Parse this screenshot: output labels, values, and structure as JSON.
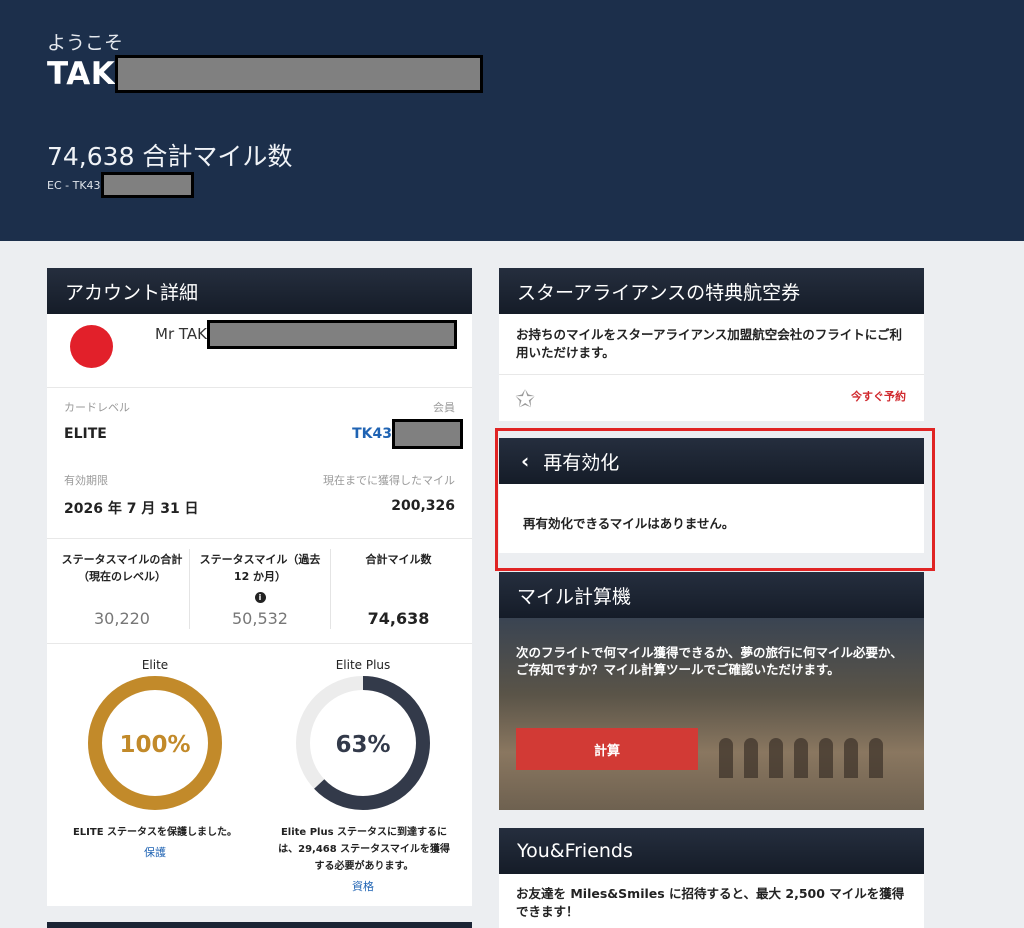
{
  "header": {
    "welcome": "ようこそ",
    "name_visible": "TAK",
    "total_miles_line": "74,638 合計マイル数",
    "member_prefix": "EC - TK43"
  },
  "account": {
    "title": "アカウント詳細",
    "name_visible": "Mr TAK",
    "card_level_label": "カードレベル",
    "card_level": "ELITE",
    "member_label": "会員",
    "member_no_prefix": "TK43",
    "expiry_label": "有効期限",
    "expiry": "2026 年 7 月 31 日",
    "earned_label": "現在までに獲得したマイル",
    "earned": "200,326",
    "stats": [
      {
        "header": "ステータスマイルの合計（現在のレベル）",
        "value": "30,220"
      },
      {
        "header": "ステータスマイル（過去 12 か月）",
        "value": "50,532"
      },
      {
        "header": "合計マイル数",
        "value": "74,638"
      }
    ],
    "rings": [
      {
        "title": "Elite",
        "percent_label": "100%",
        "progress": 1.0,
        "color": "#c28a2a",
        "text": "ELITE ステータスを保護しました。",
        "link": "保護"
      },
      {
        "title": "Elite Plus",
        "percent_label": "63%",
        "progress": 0.63,
        "color": "#333a4a",
        "text": "Elite Plus ステータスに到達するには、29,468 ステータスマイルを獲得する必要があります。",
        "link": "資格"
      }
    ]
  },
  "star_alliance": {
    "title": "スターアライアンスの特典航空券",
    "body": "お持ちのマイルをスターアライアンス加盟航空会社のフライトにご利用いただけます。",
    "book_link": "今すぐ予約"
  },
  "reactivation": {
    "title": "再有効化",
    "body": "再有効化できるマイルはありません。"
  },
  "calculator": {
    "title": "マイル計算機",
    "body": "次のフライトで何マイル獲得できるか、夢の旅行に何マイル必要か、ご存知ですか？マイル計算ツールでご確認いただけます。",
    "button": "計算"
  },
  "you_friends": {
    "title": "You&Friends",
    "body": "お友達を Miles&Smiles に招待すると、最大 2,500 マイルを獲得できます！"
  },
  "colors": {
    "header_bg": "#1c2f4b",
    "accent_red": "#d23a35",
    "link_blue": "#1f63b3",
    "elite_gold": "#c28a2a"
  }
}
